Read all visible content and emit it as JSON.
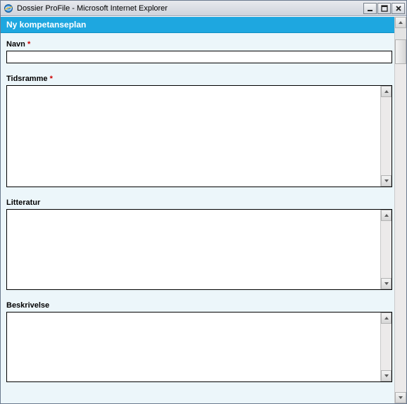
{
  "window": {
    "title": "Dossier ProFile - Microsoft Internet Explorer"
  },
  "page": {
    "heading": "Ny kompetanseplan"
  },
  "form": {
    "navn": {
      "label": "Navn",
      "required": "*",
      "value": ""
    },
    "tidsramme": {
      "label": "Tidsramme",
      "required": "*",
      "value": ""
    },
    "litteratur": {
      "label": "Litteratur",
      "required": "",
      "value": ""
    },
    "beskrivelse": {
      "label": "Beskrivelse",
      "required": "",
      "value": ""
    }
  }
}
